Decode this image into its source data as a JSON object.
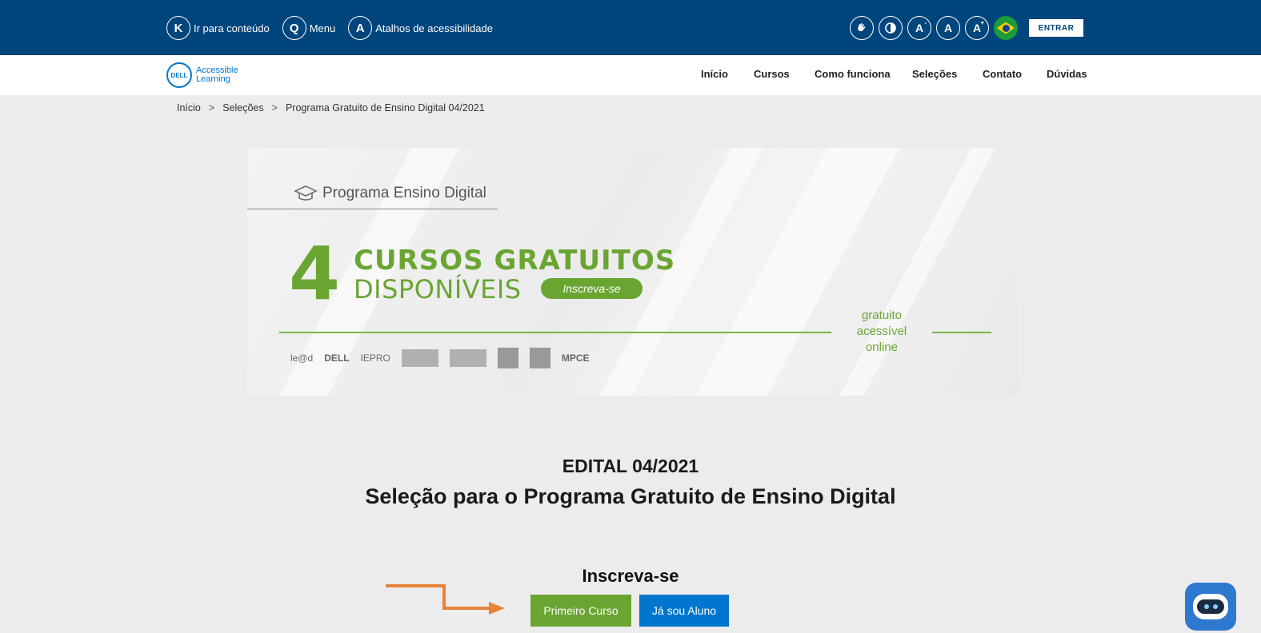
{
  "accessibility_bar": {
    "links": [
      {
        "key": "K",
        "label": "Ir para conteúdo"
      },
      {
        "key": "Q",
        "label": "Menu"
      },
      {
        "key": "A",
        "label": "Atalhos de acessibilidade"
      }
    ],
    "tools": [
      "sign-language-icon",
      "contrast-icon",
      "font-decrease-icon",
      "font-reset-icon",
      "font-increase-icon"
    ],
    "tool_letters": {
      "decrease": "A",
      "reset": "A",
      "increase": "A",
      "decrease_mark": "-",
      "increase_mark": "+"
    },
    "login_label": "ENTRAR"
  },
  "header": {
    "logo_brand": "DELL",
    "logo_line1": "Accessible",
    "logo_line2": "Learning",
    "nav": [
      "Início",
      "Cursos",
      "Como funciona",
      "Seleções",
      "Contato",
      "Dúvidas"
    ]
  },
  "breadcrumb": {
    "items": [
      "Início",
      "Seleções",
      "Programa Gratuito de Ensino Digital 04/2021"
    ],
    "separator": ">"
  },
  "banner": {
    "program_title": "Programa Ensino Digital",
    "big_number": "4",
    "headline": "CURSOS GRATUITOS",
    "subheadline": "DISPONÍVEIS",
    "pill_label": "Inscreva-se",
    "tagline": [
      "gratuito",
      "acessível",
      "online"
    ],
    "partners": [
      "le@d",
      "DELL",
      "IEPRO",
      "MPCE"
    ]
  },
  "main": {
    "edital_title": "EDITAL 04/2021",
    "edital_subtitle": "Seleção para o Programa Gratuito de Ensino Digital",
    "signup_title": "Inscreva-se",
    "btn_first": "Primeiro Curso",
    "btn_student": "Já sou Aluno"
  },
  "colors": {
    "top_bar": "#00457c",
    "green": "#6aa532",
    "blue": "#0076ce",
    "arrow": "#e8833a"
  },
  "chatbot": {
    "icon": "chatbot-icon"
  }
}
